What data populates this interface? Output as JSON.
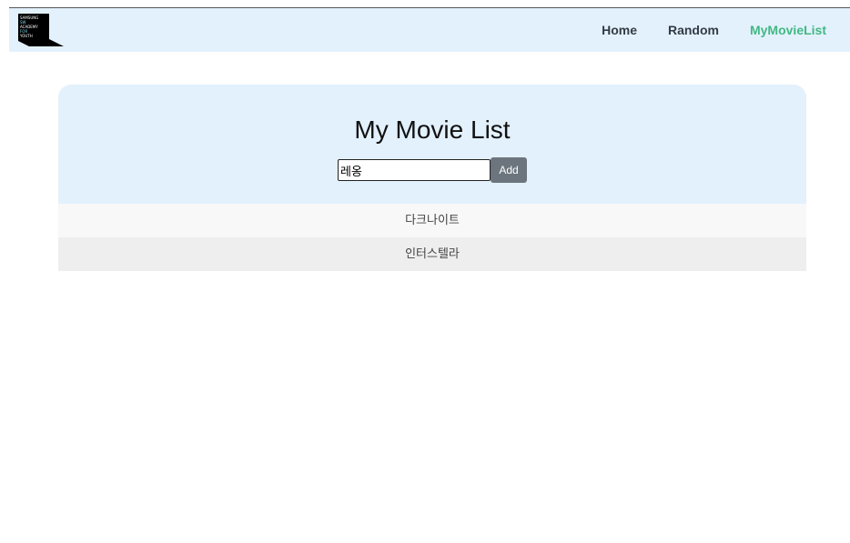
{
  "logo": {
    "lines": [
      "SAMSUNG",
      "SW",
      "ACADEMY",
      "FOR",
      "YOUTH"
    ]
  },
  "nav": {
    "home": "Home",
    "random": "Random",
    "mymovielist": "MyMovieList",
    "active_color": "#42b883"
  },
  "main": {
    "title": "My Movie List",
    "input_value": "레옹",
    "add_label": "Add",
    "movies": [
      "다크나이트",
      "인터스텔라"
    ]
  },
  "colors": {
    "header_bg": "#e3f1fd",
    "button_bg": "#6c757d"
  }
}
